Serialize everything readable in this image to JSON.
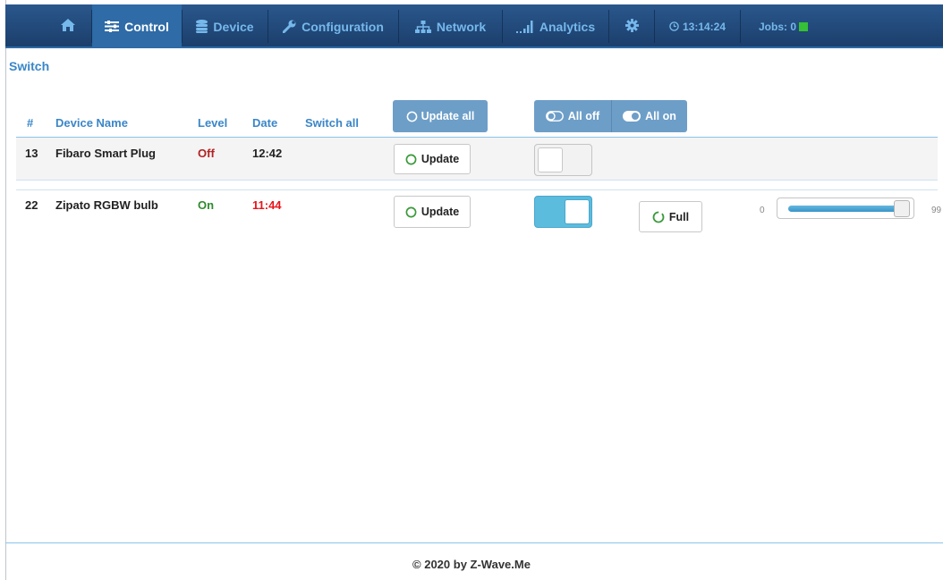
{
  "nav": {
    "home_icon": "home-icon",
    "control": "Control",
    "device": "Device",
    "configuration": "Configuration",
    "network": "Network",
    "analytics": "Analytics",
    "settings_icon": "gear-icon",
    "time": "13:14:24",
    "jobs": "Jobs: 0",
    "jobs_color": "#35c035"
  },
  "page": {
    "title": "Switch"
  },
  "table": {
    "headers": {
      "id": "#",
      "name": "Device Name",
      "level": "Level",
      "date": "Date",
      "switch_all": "Switch all"
    },
    "update_all": "Update all",
    "all_off": "All off",
    "all_on": "All on",
    "rows": [
      {
        "id": "13",
        "name": "Fibaro Smart Plug",
        "level": "Off",
        "date": "12:42",
        "update": "Update",
        "switch_on": false
      },
      {
        "id": "22",
        "name": "Zipato RGBW bulb",
        "level": "On",
        "date": "11:44",
        "update": "Update",
        "switch_on": true,
        "full": "Full",
        "slider": {
          "min": "0",
          "max": "99",
          "value": 99
        }
      }
    ]
  },
  "colors": {
    "accent": "#3a86c8",
    "nav_bg": "#1f4677",
    "on": "#2e8b2e",
    "off": "#b22222",
    "date_alert": "#e8141c",
    "toggle_on": "#5bbcde"
  },
  "footer": {
    "text": "© 2020 by Z-Wave.Me"
  }
}
